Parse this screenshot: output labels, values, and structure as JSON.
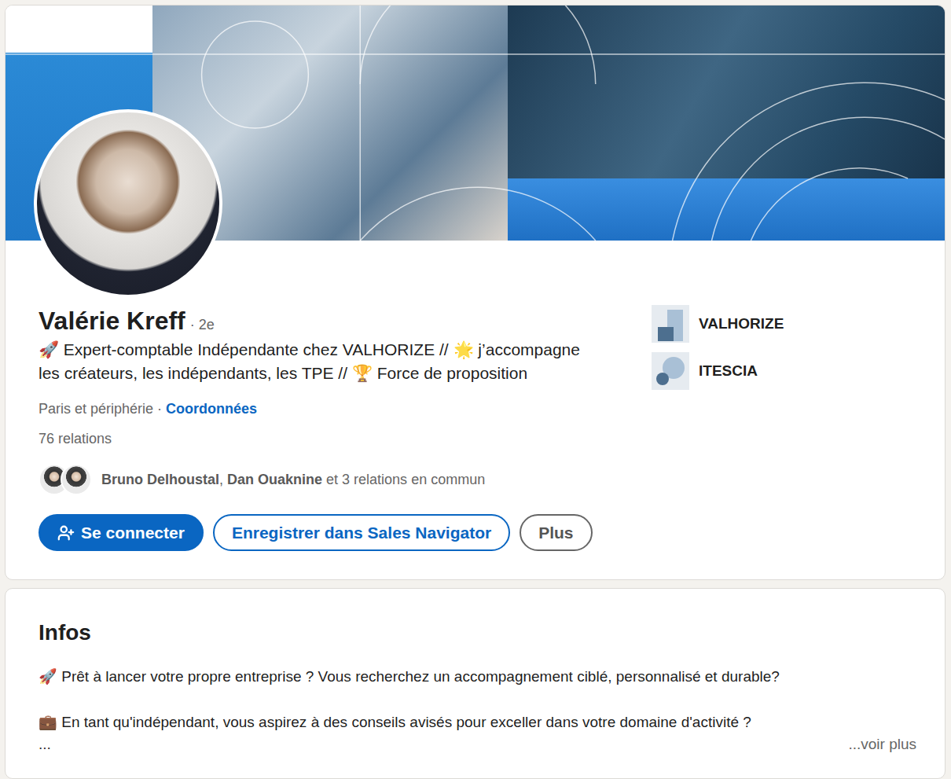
{
  "profile": {
    "name": "Valérie Kreff",
    "degree": "· 2e",
    "headline": "🚀 Expert-comptable Indépendante chez VALHORIZE // 🌟 j’accompagne les créateurs, les indépendants, les TPE // 🏆 Force de proposition",
    "location": "Paris et périphérie",
    "location_separator": " · ",
    "contact_link": "Coordonnées",
    "connections": "76 relations"
  },
  "mutual": {
    "parts": [
      {
        "text": "Bruno Delhoustal",
        "bold": true
      },
      {
        "text": ", ",
        "bold": false
      },
      {
        "text": "Dan Ouaknine",
        "bold": true
      },
      {
        "text": " et 3 relations en commun",
        "bold": false
      }
    ],
    "avatars": [
      {
        "color": "#f2c230"
      },
      {
        "color": "#8a8a8a"
      }
    ]
  },
  "buttons": [
    {
      "label": "Se connecter",
      "kind": "primary"
    },
    {
      "label": "Enregistrer dans Sales Navigator",
      "kind": "secondary"
    },
    {
      "label": "Plus",
      "kind": "tertiary"
    }
  ],
  "companies": [
    {
      "name": "VALHORIZE",
      "kind": "bars"
    },
    {
      "name": "ITESCIA",
      "kind": "circles"
    }
  ],
  "about": {
    "title": "Infos",
    "lines": [
      "🚀 Prêt à lancer votre propre entreprise ? Vous recherchez un accompagnement ciblé, personnalisé et durable?",
      "💼 En tant qu'indépendant, vous aspirez à des conseils avisés pour exceller dans votre domaine d'activité ?"
    ],
    "ellipsis": "...",
    "see_more": "...voir plus"
  }
}
